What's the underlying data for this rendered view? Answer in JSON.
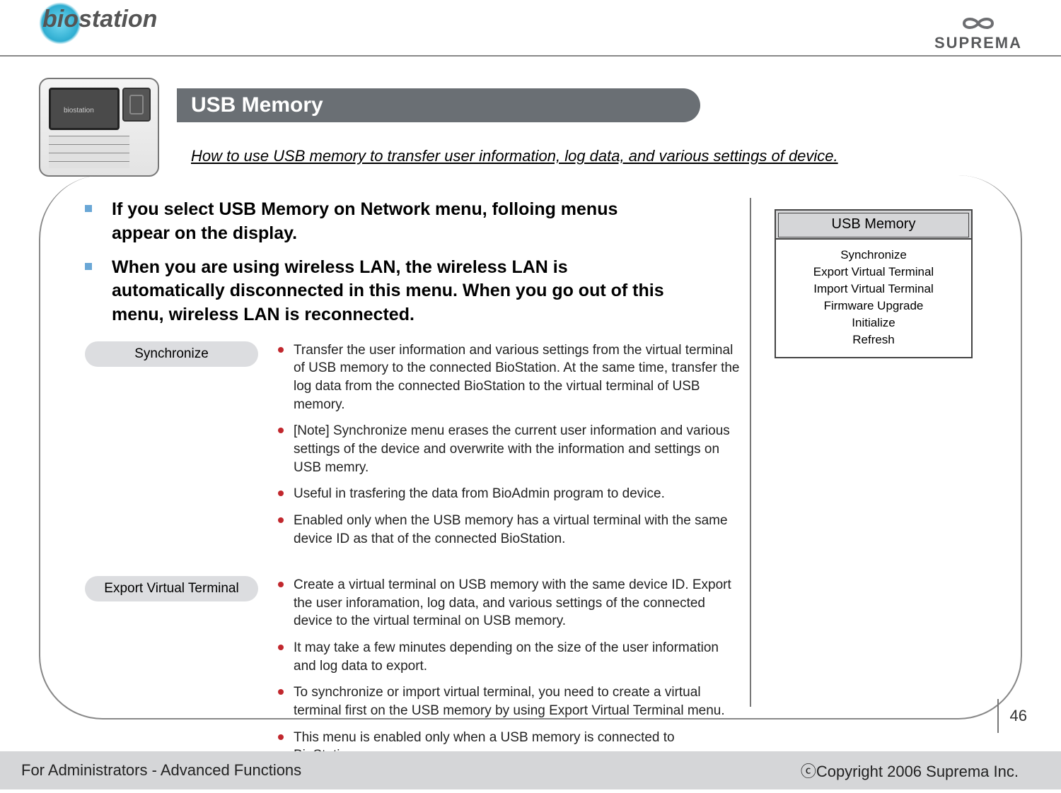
{
  "header": {
    "logo_left_a": "bio",
    "logo_left_b": "station",
    "logo_right": "SUPREMA"
  },
  "title": "USB Memory",
  "subtitle": "How to use USB memory to transfer user information, log data, and various settings of device.",
  "intro": {
    "item1": "If you select USB Memory on Network menu, folloing menus appear on the display.",
    "item2": "When you are using wireless LAN, the wireless LAN is automatically disconnected in this menu. When you go out of this menu, wireless LAN is reconnected."
  },
  "sections": {
    "sync": {
      "label": "Synchronize",
      "b1": "Transfer the user information and various settings from the virtual terminal of USB memory to the connected BioStation. At the same time, transfer the log data from the connected BioStation to the virtual terminal of USB memory.",
      "b2": "[Note] Synchronize menu erases the current user information and various settings of the device and overwrite with the information and settings on USB memry.",
      "b3": "Useful in trasfering the data from BioAdmin program to device.",
      "b4": "Enabled only when the USB memory has a virtual terminal with the same device ID as that of the connected BioStation."
    },
    "export": {
      "label": "Export Virtual Terminal",
      "b1": "Create a virtual terminal on USB memory with the same device ID. Export the user inforamation, log data, and various settings of the connected device to the virtual terminal on USB memory.",
      "b2": "It may take a few minutes depending on the size of the user information and log data to export.",
      "b3": "To synchronize or import virtual terminal, you need to create a virtual terminal first on the USB memory by using Export Virtual Terminal menu.",
      "b4": "This menu is enabled only when a USB memory is connected to BioStation."
    }
  },
  "side_panel": {
    "title": "USB Memory",
    "i1": "Synchronize",
    "i2": "Export Virtual Terminal",
    "i3": "Import Virtual Terminal",
    "i4": "Firmware Upgrade",
    "i5": "Initialize",
    "i6": "Refresh"
  },
  "page_number": "46",
  "footer": {
    "left": "For Administrators - Advanced Functions",
    "right": "ⓒCopyright 2006 Suprema Inc."
  }
}
